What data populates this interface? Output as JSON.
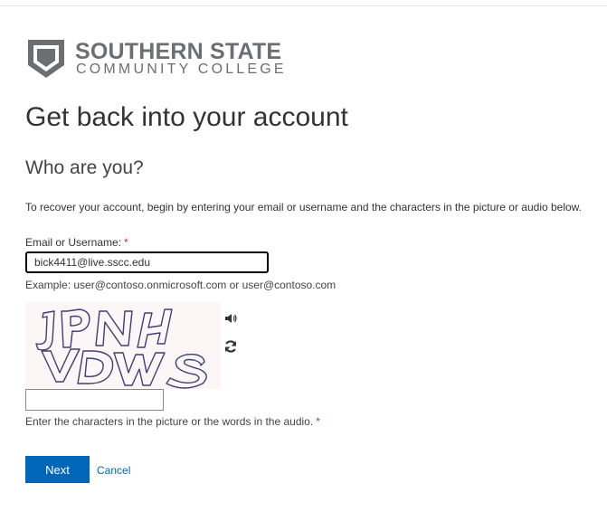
{
  "logo": {
    "line1": "SOUTHERN STATE",
    "line2": "COMMUNITY COLLEGE",
    "color": "#6d6e71"
  },
  "page": {
    "title": "Get back into your account",
    "subtitle": "Who are you?",
    "intro": "To recover your account, begin by entering your email or username and the characters in the picture or audio below."
  },
  "form": {
    "email_label": "Email or Username:",
    "required_marker": "*",
    "email_value": "bick4411@live.sscc.edu",
    "example": "Example: user@contoso.onmicrosoft.com or user@contoso.com",
    "captcha_text": "JPNHVDWS",
    "captcha_value": "",
    "captcha_label": "Enter the characters in the picture or the words in the audio.",
    "audio_icon": "speaker-icon",
    "refresh_icon": "refresh-icon"
  },
  "actions": {
    "next_label": "Next",
    "cancel_label": "Cancel",
    "accent": "#0067b8"
  }
}
